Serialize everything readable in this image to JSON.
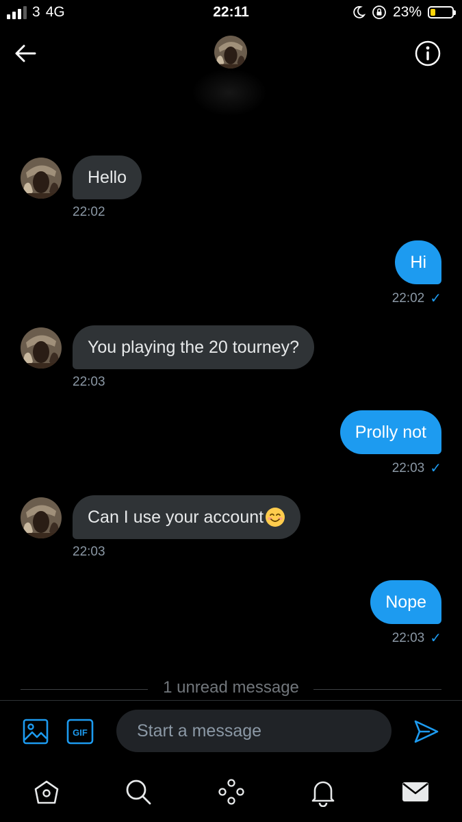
{
  "status_bar": {
    "carrier": "3",
    "network": "4G",
    "time": "22:11",
    "battery": "23%",
    "battery_level": 0.23,
    "signal_bars_active": 3,
    "signal_bars_total": 4
  },
  "header": {
    "back_icon": "arrow-left-icon",
    "info_icon": "info-icon"
  },
  "messages": [
    {
      "direction": "incoming",
      "text": "Hello",
      "time": "22:02"
    },
    {
      "direction": "outgoing",
      "text": "Hi",
      "time": "22:02",
      "status": "✓"
    },
    {
      "direction": "incoming",
      "text": "You playing the 20 tourney?",
      "time": "22:03"
    },
    {
      "direction": "outgoing",
      "text": "Prolly not",
      "time": "22:03",
      "status": "✓"
    },
    {
      "direction": "incoming",
      "text": "Can I use your account",
      "emoji": "smiling-face-emoji",
      "time": "22:03"
    },
    {
      "direction": "outgoing",
      "text": "Nope",
      "time": "22:03",
      "status": "✓"
    }
  ],
  "unread_divider": "1 unread message",
  "composer": {
    "placeholder": "Start a message",
    "gif_label": "GIF"
  },
  "bottom_nav": [
    "home-icon",
    "search-icon",
    "spaces-icon",
    "notifications-icon",
    "messages-icon"
  ],
  "colors": {
    "background": "#000000",
    "incoming_bubble": "#2f3336",
    "outgoing_bubble": "#1d9bf0",
    "accent": "#1d9bf0",
    "timestamp": "#8b98a5"
  }
}
